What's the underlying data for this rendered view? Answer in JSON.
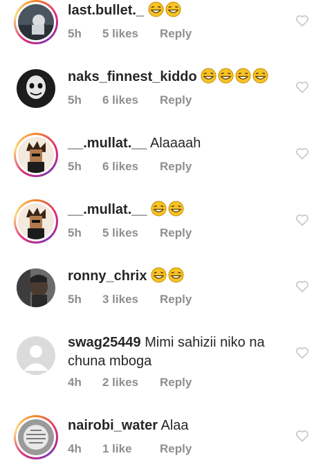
{
  "comments": [
    {
      "username": "last.bullet._",
      "text": "",
      "emoji_count": 2,
      "time": "5h",
      "likes": "5 likes",
      "reply": "Reply"
    },
    {
      "username": "naks_finnest_kiddo",
      "text": "",
      "emoji_count": 4,
      "time": "5h",
      "likes": "6 likes",
      "reply": "Reply"
    },
    {
      "username": "__.mullat.__",
      "text": "Alaaaah",
      "emoji_count": 0,
      "time": "5h",
      "likes": "6 likes",
      "reply": "Reply"
    },
    {
      "username": "__.mullat.__",
      "text": "",
      "emoji_count": 2,
      "time": "5h",
      "likes": "5 likes",
      "reply": "Reply"
    },
    {
      "username": "ronny_chrix",
      "text": "",
      "emoji_count": 2,
      "time": "5h",
      "likes": "3 likes",
      "reply": "Reply"
    },
    {
      "username": "swag25449",
      "text": "Mimi sahizii niko na chuna mboga",
      "emoji_count": 0,
      "time": "4h",
      "likes": "2 likes",
      "reply": "Reply"
    },
    {
      "username": "nairobi_water",
      "text": "Alaa",
      "emoji_count": 0,
      "time": "4h",
      "likes": "1 like",
      "reply": "Reply"
    }
  ],
  "colors": {
    "text": "#262626",
    "meta": "#8e8e8e",
    "heart": "#c7c7c7",
    "emoji": "#f7c325"
  },
  "icons": {
    "like": "heart-outline-icon",
    "emoji": "laughing-emoji-icon"
  }
}
